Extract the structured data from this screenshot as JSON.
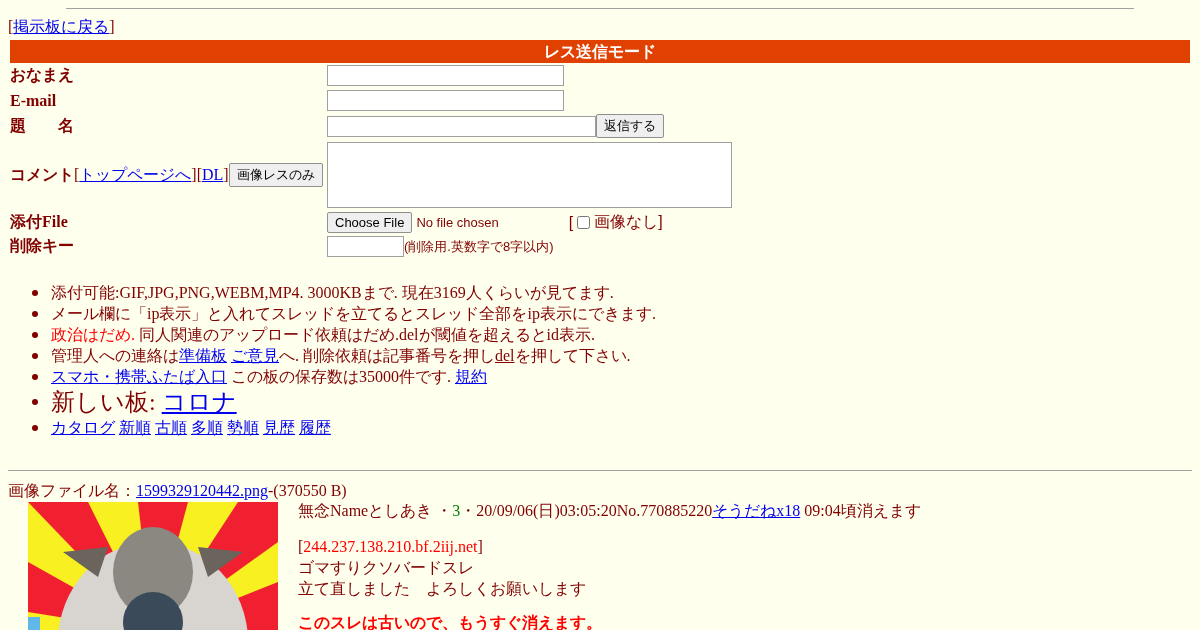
{
  "back_link": {
    "open": "[",
    "label": "掲示板に戻る",
    "close": "]"
  },
  "form": {
    "title": "レス送信モード",
    "name_label": "おなまえ",
    "email_label": "E-mail",
    "subject_label": "題　　名",
    "submit_button": "返信する",
    "comment_label": "コメント",
    "comment_links": [
      {
        "open": "[",
        "label": "トップページへ",
        "close": "]"
      },
      {
        "open": "[",
        "label": "DL",
        "close": "]"
      }
    ],
    "image_only_button": "画像レスのみ",
    "file_label": "添付File",
    "file_button": "Choose File",
    "file_status": "No file chosen",
    "no_image": {
      "open": "[",
      "label": "画像なし]",
      "checked": false
    },
    "delete_key_label": "削除キー",
    "delete_key_hint": "(削除用.英数字で8字以内)"
  },
  "notices": [
    {
      "kind": "plain",
      "parts": [
        {
          "kind": "text",
          "text": "添付可能:GIF,JPG,PNG,WEBM,MP4. 3000KBまで. 現在3169人くらいが見てます."
        }
      ]
    },
    {
      "kind": "plain",
      "parts": [
        {
          "kind": "text",
          "text": "メール欄に「ip表示」と入れてスレッドを立てるとスレッド全部をip表示にできます."
        }
      ]
    },
    {
      "kind": "plain",
      "parts": [
        {
          "kind": "alert",
          "text": "政治はだめ."
        },
        {
          "kind": "text",
          "text": " 同人関連のアップロード依頼はだめ.delが閾値を超えるとid表示."
        }
      ]
    },
    {
      "kind": "plain",
      "parts": [
        {
          "kind": "text",
          "text": "管理人への連絡は"
        },
        {
          "kind": "link",
          "text": "準備板"
        },
        {
          "kind": "link",
          "text": "ご意見"
        },
        {
          "kind": "text",
          "text": "へ. 削除依頼は記事番号を押し"
        },
        {
          "kind": "underlined",
          "text": "del"
        },
        {
          "kind": "text",
          "text": "を押して下さい."
        }
      ]
    },
    {
      "kind": "plain",
      "parts": [
        {
          "kind": "link",
          "text": "スマホ・携帯ふたば入口"
        },
        {
          "kind": "text",
          "text": " この板の保存数は35000件です. "
        },
        {
          "kind": "link",
          "text": "規約"
        }
      ]
    },
    {
      "kind": "headline",
      "parts": [
        {
          "kind": "text",
          "text": "新しい板: "
        },
        {
          "kind": "link",
          "text": "コロナ"
        }
      ]
    },
    {
      "kind": "plain",
      "parts": [
        {
          "kind": "link",
          "text": "カタログ"
        },
        {
          "kind": "link",
          "text": "新順"
        },
        {
          "kind": "link",
          "text": "古順"
        },
        {
          "kind": "link",
          "text": "多順"
        },
        {
          "kind": "link",
          "text": "勢順"
        },
        {
          "kind": "link",
          "text": "見歴"
        },
        {
          "kind": "link",
          "text": "履歴"
        }
      ]
    }
  ],
  "post": {
    "file_label": "画像ファイル名：",
    "file_name": "1599329120442.png",
    "file_size": "-(370550 B)",
    "image": {
      "kind": "picture"
    },
    "subject": "無念",
    "name": "Nameとしあき",
    "id_prefix": " ・",
    "id_count": "3",
    "id_suffix": "・",
    "datetime": "20/09/06(日)03:05:20No.770885220",
    "soudane": "そうだねx18",
    "expiry": " 09:04頃消えます",
    "ip_open": "[",
    "ip": "244.237.138.210.bf.2iij.net",
    "ip_close": "]",
    "lines": [
      "ゴマすりクソバードスレ",
      "立て直しました　よろしくお願いします"
    ],
    "warning": "このスレは古いので、もうすぐ消えます。"
  }
}
